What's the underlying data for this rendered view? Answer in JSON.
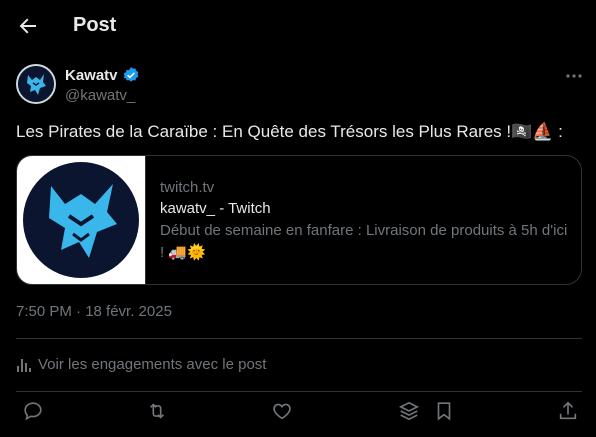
{
  "header": {
    "title": "Post"
  },
  "author": {
    "name": "Kawatv",
    "handle": "@kawatv_"
  },
  "post": {
    "text": "Les Pirates de la Caraïbe : En Quête des Trésors les Plus Rares !🏴‍☠️⛵ :",
    "timestamp": "7:50 PM · 18 févr. 2025"
  },
  "card": {
    "domain": "twitch.tv",
    "title": "kawatv_ - Twitch",
    "description": "Début de semaine en fanfare : Livraison de produits à 5h d'ici ! 🚚🌞"
  },
  "engagements": {
    "label": "Voir les engagements avec le post"
  },
  "icons": {
    "back": "arrow-left-icon",
    "verified": "verified-badge-icon",
    "more": "more-options-icon",
    "reply": "reply-icon",
    "repost": "repost-icon",
    "like": "like-icon",
    "share_stack": "layers-icon",
    "bookmark": "bookmark-icon",
    "share": "share-icon"
  },
  "colors": {
    "background": "#000000",
    "text": "#e7e9ea",
    "muted": "#71767b",
    "verified": "#1d9bf0",
    "border": "#2f3336"
  }
}
